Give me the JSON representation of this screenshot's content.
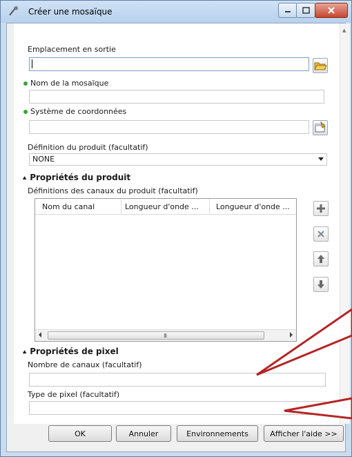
{
  "window": {
    "title": "Créer une mosaïque"
  },
  "fields": {
    "output_location": {
      "label": "Emplacement en sortie",
      "value": ""
    },
    "mosaic_name": {
      "label": "Nom de la mosaïque",
      "value": ""
    },
    "coordinate_system": {
      "label": "Système de coordonnées",
      "value": ""
    },
    "product_definition": {
      "label": "Définition du produit (facultatif)",
      "value": "NONE"
    }
  },
  "product_properties": {
    "title": "Propriétés du produit",
    "band_definitions_label": "Définitions des canaux du produit (facultatif)",
    "columns": [
      "Nom du canal",
      "Longueur d'onde ...",
      "Longueur d'onde ..."
    ],
    "rows": [],
    "scroll_grip": "III"
  },
  "pixel_properties": {
    "title": "Propriétés de pixel",
    "band_count": {
      "label": "Nombre de canaux (facultatif)",
      "value": ""
    },
    "pixel_type": {
      "label": "Type de pixel (facultatif)",
      "value": ""
    }
  },
  "buttons": {
    "ok": "OK",
    "cancel": "Annuler",
    "environments": "Environnements",
    "show_help": "Afficher l'aide >>"
  },
  "icons": {
    "title_app": "arcgis-tool-icon",
    "folder": "open-folder-icon",
    "coordinate": "spatial-reference-icon",
    "add": "plus-icon",
    "remove": "x-icon",
    "up": "arrow-up-icon",
    "down": "arrow-down-icon"
  },
  "colors": {
    "required_dot": "#3aa33a",
    "annotation_arrow": "#b42525",
    "close_button": "#c8452f"
  }
}
